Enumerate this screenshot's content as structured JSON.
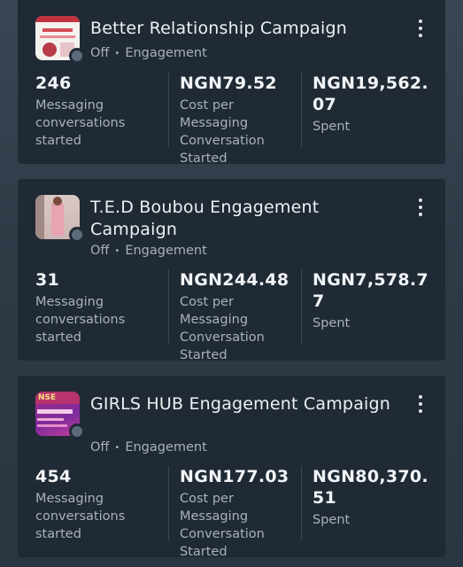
{
  "campaigns": [
    {
      "name": "Better Relationship Campaign",
      "status": "Off",
      "objective": "Engagement",
      "metrics": [
        {
          "value": "246",
          "label": "Messaging conversations started"
        },
        {
          "value": "NGN79.52",
          "label": "Cost per Messaging Conversation Started"
        },
        {
          "value": "NGN19,562.07",
          "label": "Spent"
        }
      ]
    },
    {
      "name": "T.E.D Boubou Engagement Campaign",
      "status": "Off",
      "objective": "Engagement",
      "metrics": [
        {
          "value": "31",
          "label": "Messaging conversations started"
        },
        {
          "value": "NGN244.48",
          "label": "Cost per Messaging Conversation Started"
        },
        {
          "value": "NGN7,578.77",
          "label": "Spent"
        }
      ]
    },
    {
      "name": "GIRLS HUB Engagement Campaign",
      "status": "Off",
      "objective": "Engagement",
      "thumb_text": "NSE",
      "metrics": [
        {
          "value": "454",
          "label": "Messaging conversations started"
        },
        {
          "value": "NGN177.03",
          "label": "Cost per Messaging Conversation Started"
        },
        {
          "value": "NGN80,370.51",
          "label": "Spent"
        }
      ]
    }
  ],
  "separator": "•",
  "icons": {
    "menu": "more-vertical-icon",
    "status": "status-dot-icon"
  }
}
